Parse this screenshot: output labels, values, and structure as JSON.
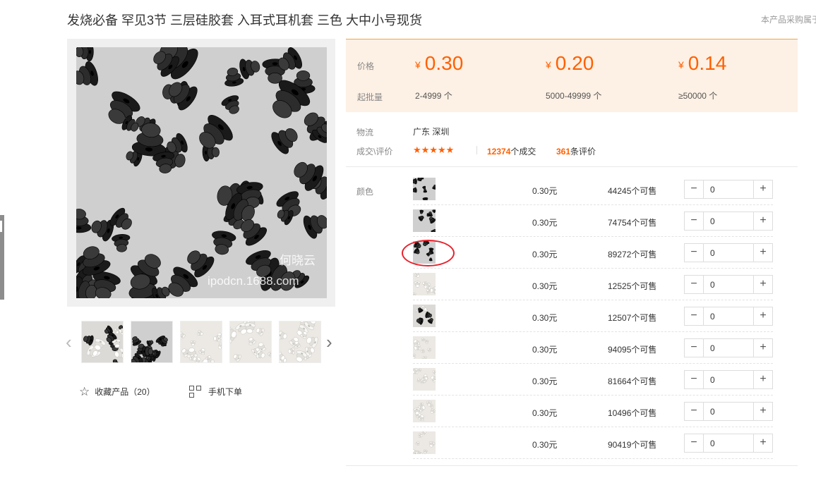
{
  "product": {
    "title": "发烧必备 罕见3节 三层硅胶套 入耳式耳机套 三色 大中小号现货",
    "top_right_note": "本产品采购属于"
  },
  "gallery": {
    "watermark_name": "何晓云",
    "watermark_url": "ipodcn.1688.com",
    "prev_icon": "chevron-left-icon",
    "next_icon": "chevron-right-icon",
    "thumbnails": [
      {
        "theme": "mixed"
      },
      {
        "theme": "black"
      },
      {
        "theme": "white"
      },
      {
        "theme": "white"
      },
      {
        "theme": "white"
      }
    ]
  },
  "actions": {
    "favorite_label": "收藏产品（20）",
    "favorite_icon": "star-outline-icon",
    "mobile_label": "手机下单",
    "mobile_icon": "qr-code-icon"
  },
  "pricing": {
    "price_label": "价格",
    "moq_label": "起批量",
    "currency_symbol": "¥",
    "tiers": [
      {
        "price": "0.30",
        "range": "2-4999 个"
      },
      {
        "price": "0.20",
        "range": "5000-49999 个"
      },
      {
        "price": "0.14",
        "range": "≥50000 个"
      }
    ],
    "accent_color": "#ff6000",
    "panel_bg": "#fdf0e4"
  },
  "logistics": {
    "label": "物流",
    "value": "广东 深圳"
  },
  "deals": {
    "label": "成交\\评价",
    "rating": 4.5,
    "stars_text": "★★★★★",
    "deal_count": "12374",
    "deal_suffix": "个成交",
    "review_count": "361",
    "review_suffix": "条评价"
  },
  "sku": {
    "label": "颜色",
    "minus": "−",
    "plus": "+",
    "rows": [
      {
        "theme": "black",
        "price": "0.30元",
        "stock": "44245个可售",
        "qty": "0"
      },
      {
        "theme": "black",
        "price": "0.30元",
        "stock": "74754个可售",
        "qty": "0"
      },
      {
        "theme": "black",
        "price": "0.30元",
        "stock": "89272个可售",
        "qty": "0",
        "highlighted": true
      },
      {
        "theme": "white",
        "price": "0.30元",
        "stock": "12525个可售",
        "qty": "0"
      },
      {
        "theme": "mixed",
        "price": "0.30元",
        "stock": "12507个可售",
        "qty": "0"
      },
      {
        "theme": "white",
        "price": "0.30元",
        "stock": "94095个可售",
        "qty": "0"
      },
      {
        "theme": "white",
        "price": "0.30元",
        "stock": "81664个可售",
        "qty": "0"
      },
      {
        "theme": "white",
        "price": "0.30元",
        "stock": "10496个可售",
        "qty": "0"
      },
      {
        "theme": "white",
        "price": "0.30元",
        "stock": "90419个可售",
        "qty": "0"
      }
    ]
  }
}
